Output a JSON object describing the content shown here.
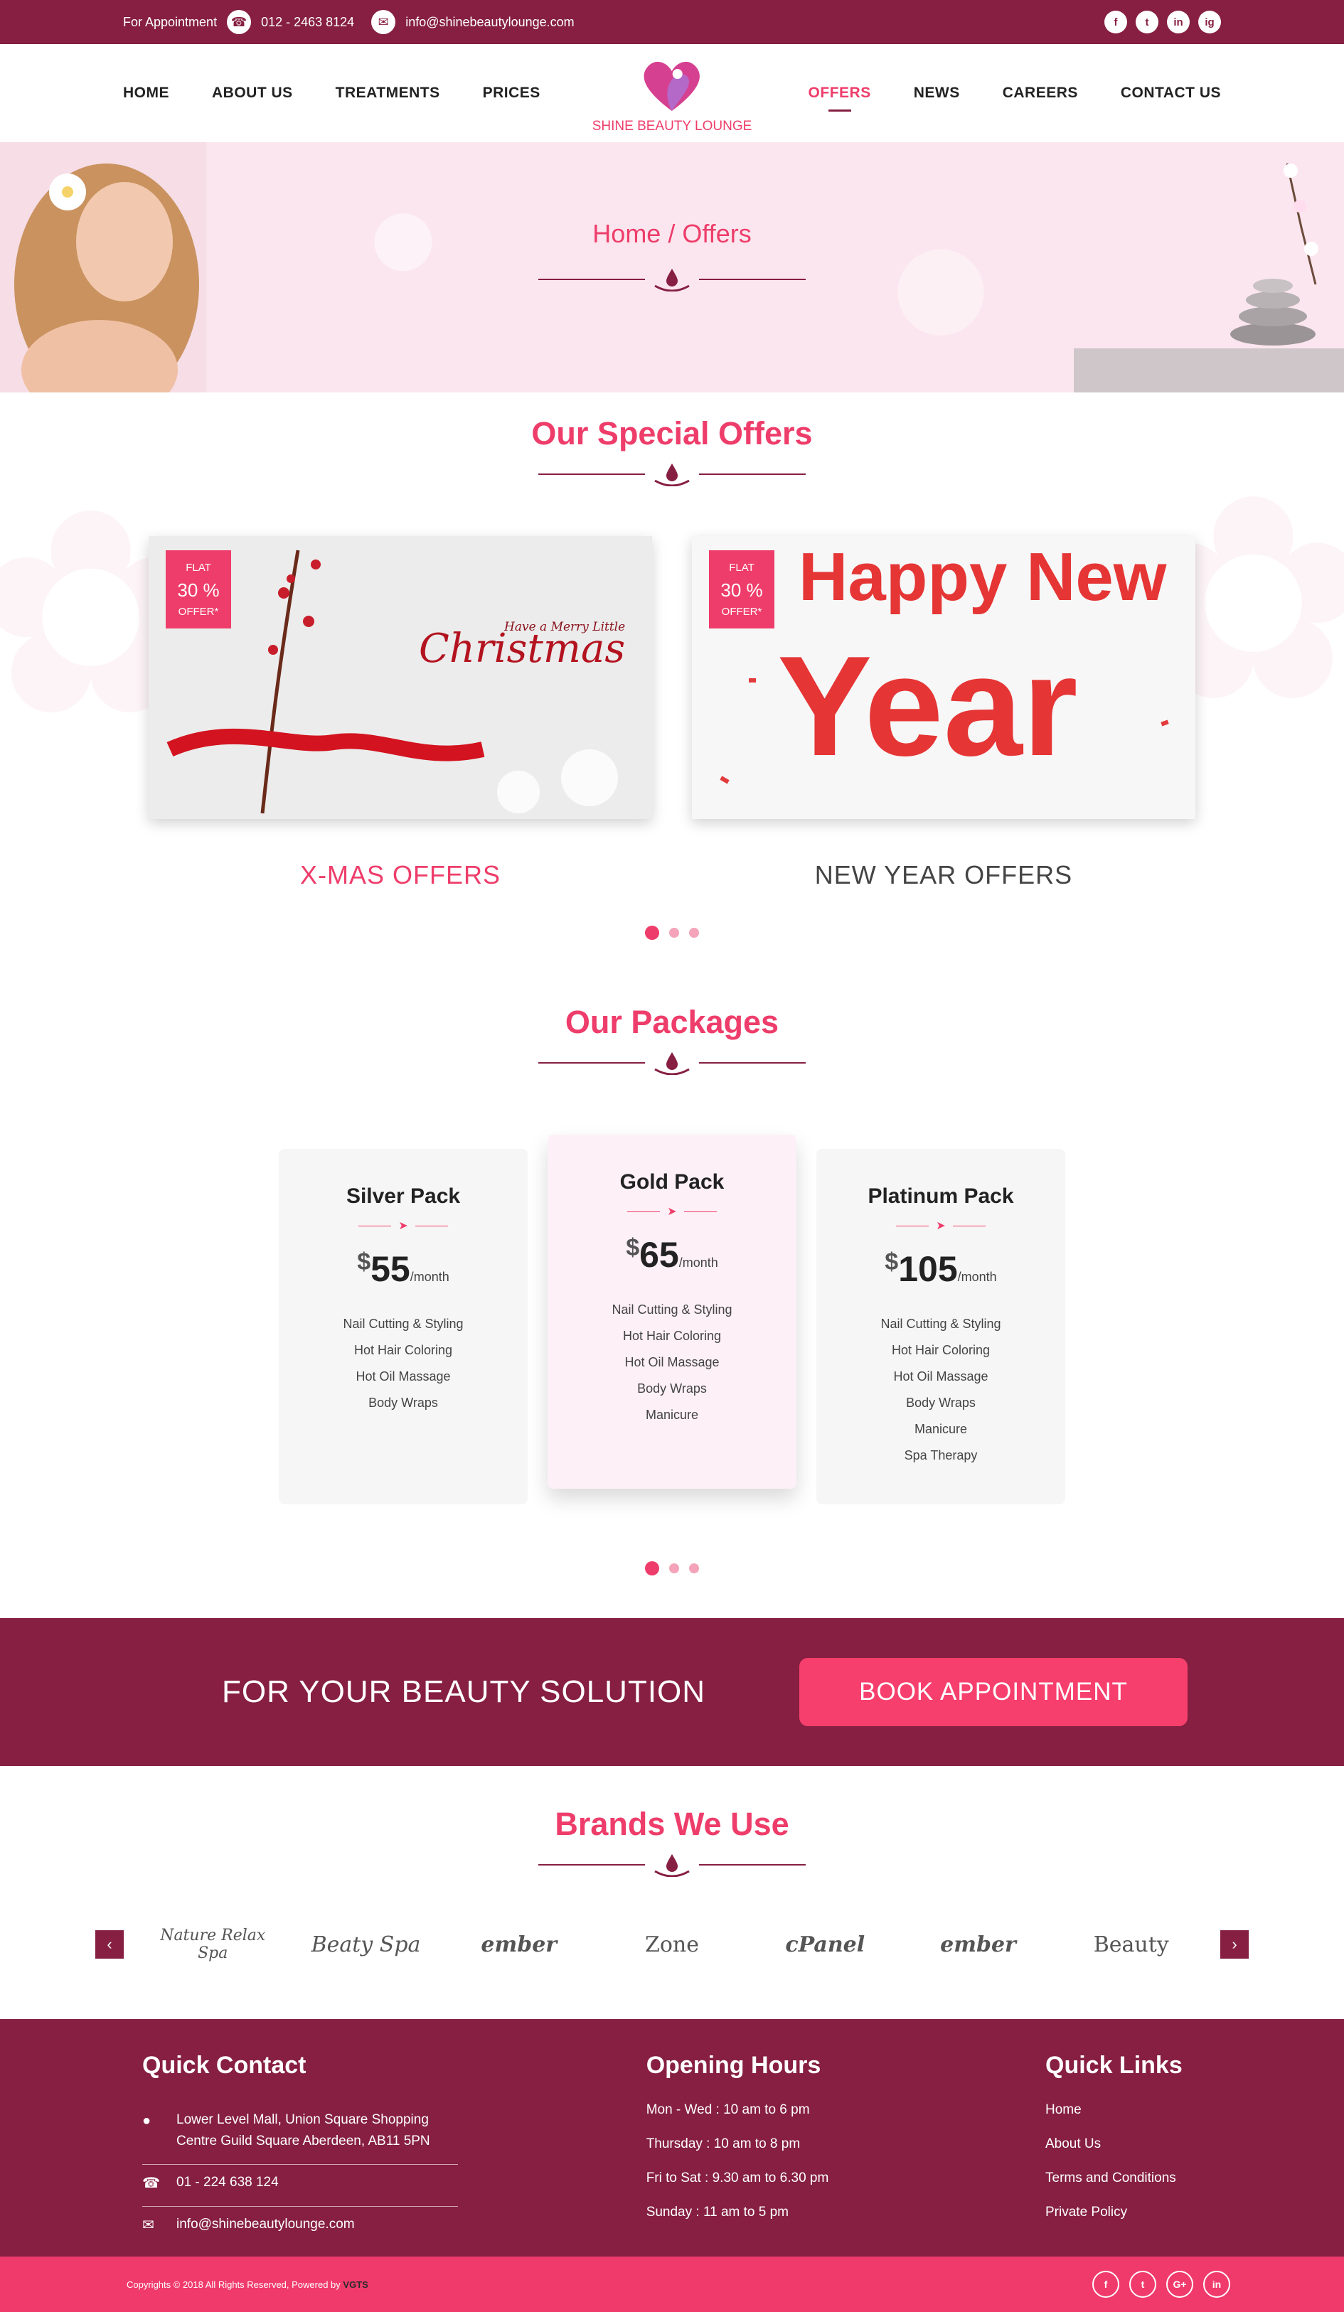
{
  "topbar": {
    "appointment_label": "For Appointment",
    "phone": "012 - 2463 8124",
    "email": "info@shinebeautylounge.com",
    "socials": [
      "f",
      "t",
      "in",
      "ig"
    ]
  },
  "nav": {
    "left": [
      "HOME",
      "ABOUT US",
      "TREATMENTS",
      "PRICES"
    ],
    "right": [
      "OFFERS",
      "NEWS",
      "CAREERS",
      "CONTACT US"
    ],
    "active": "OFFERS",
    "logo_text": "SHINE BEAUTY LOUNGE"
  },
  "banner": {
    "breadcrumb": "Home / Offers"
  },
  "offers": {
    "title": "Our Special Offers",
    "cards": [
      {
        "badge_top": "FLAT",
        "badge_pct": "30 %",
        "badge_bottom": "OFFER*",
        "image_text_small": "Have a Merry Little",
        "image_text_big": "Christmas",
        "title": "X-MAS OFFERS",
        "title_color": "#ee3d6a"
      },
      {
        "badge_top": "FLAT",
        "badge_pct": "30 %",
        "badge_bottom": "OFFER*",
        "image_text_small": "Happy New",
        "image_text_big": "Year",
        "title": "NEW YEAR OFFERS",
        "title_color": "#444444"
      }
    ]
  },
  "packages": {
    "title": "Our Packages",
    "items": [
      {
        "name": "Silver Pack",
        "currency": "$",
        "price": "55",
        "period": "/month",
        "features": [
          "Nail Cutting & Styling",
          "Hot Hair Coloring",
          "Hot Oil Massage",
          "Body Wraps"
        ]
      },
      {
        "name": "Gold Pack",
        "currency": "$",
        "price": "65",
        "period": "/month",
        "features": [
          "Nail Cutting & Styling",
          "Hot Hair Coloring",
          "Hot Oil Massage",
          "Body Wraps",
          "Manicure"
        ]
      },
      {
        "name": "Platinum Pack",
        "currency": "$",
        "price": "105",
        "period": "/month",
        "features": [
          "Nail Cutting & Styling",
          "Hot Hair Coloring",
          "Hot Oil Massage",
          "Body Wraps",
          "Manicure",
          "Spa Therapy"
        ]
      }
    ]
  },
  "cta": {
    "text": "FOR YOUR BEAUTY SOLUTION",
    "button": "BOOK APPOINTMENT"
  },
  "brands": {
    "title": "Brands We Use",
    "items": [
      "Nature Relax Spa",
      "Beaty Spa",
      "ember",
      "Zone",
      "cPanel",
      "ember",
      "Beauty"
    ]
  },
  "footer": {
    "contact_title": "Quick Contact",
    "address": "Lower Level Mall, Union Square Shopping Centre Guild Square Aberdeen, AB11 5PN",
    "phone": "01 - 224 638 124",
    "email": "info@shinebeautylounge.com",
    "hours_title": "Opening Hours",
    "hours": [
      "Mon - Wed : 10 am to 6 pm",
      "Thursday : 10 am  to 8 pm",
      "Fri to Sat : 9.30 am  to 6.30 pm",
      "Sunday : 11 am to 5 pm"
    ],
    "links_title": "Quick Links",
    "links": [
      "Home",
      "About Us",
      "Terms and Conditions",
      "Private Policy"
    ]
  },
  "copyright": {
    "text": "Copyrights © 2018 All Rights Reserved, Powered by ",
    "brand": "VGTS",
    "socials": [
      "f",
      "t",
      "G+",
      "in"
    ]
  },
  "colors": {
    "primary": "#861f41",
    "accent": "#ee3d6a",
    "light": "#fbe6ef"
  }
}
